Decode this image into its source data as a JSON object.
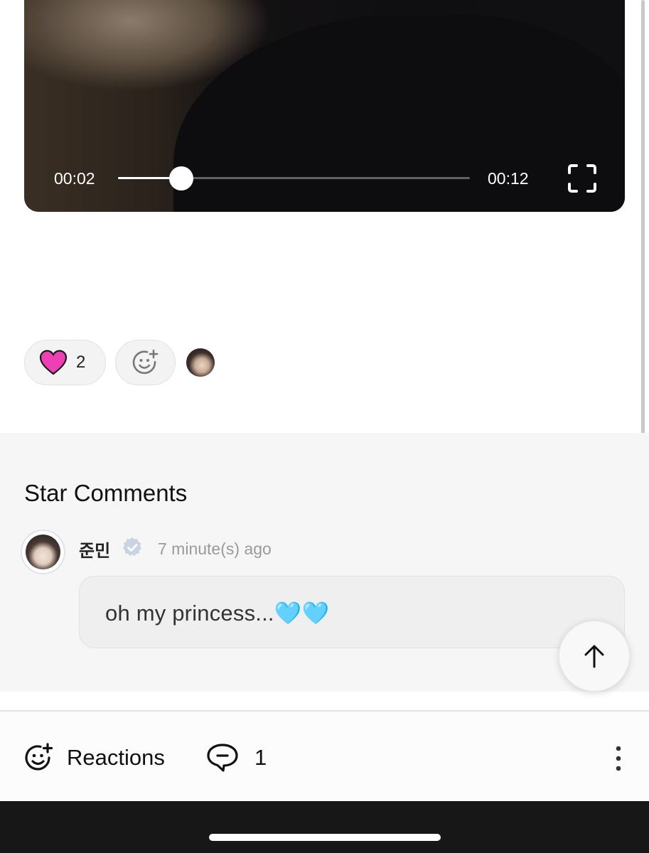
{
  "video": {
    "current_time": "00:02",
    "total_time": "00:12",
    "progress": 0.18
  },
  "reactions": {
    "heart_emoji": "heart",
    "heart_color": "#ee3fb4",
    "heart_count": "2"
  },
  "comments_section": {
    "title": "Star Comments",
    "comment": {
      "author": "준민",
      "time": "7 minute(s) ago",
      "text": "oh my princess...🩵🩵"
    }
  },
  "action_bar": {
    "reactions_label": "Reactions",
    "comment_count": "1"
  },
  "colors": {
    "verified_badge": "#c9d3e2",
    "comments_background": "#f6f6f6",
    "nav_bar": "#171717"
  }
}
